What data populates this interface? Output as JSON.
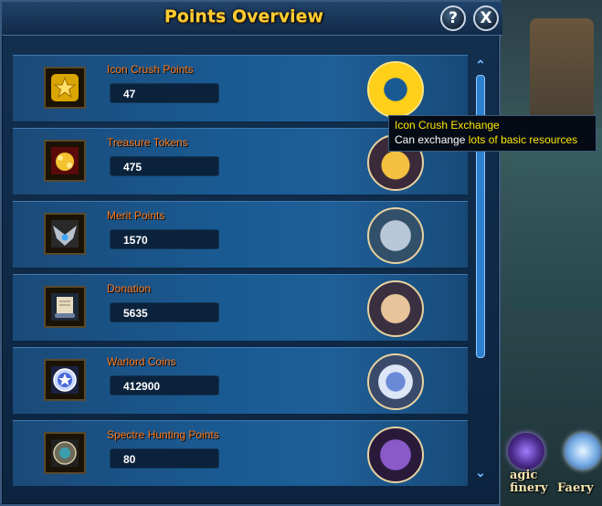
{
  "window": {
    "title": "Points Overview",
    "help_label": "?",
    "close_label": "X"
  },
  "points": [
    {
      "label": "Icon Crush Points",
      "value": "47",
      "icon": "star-icon",
      "medal": "gold-ring-icon"
    },
    {
      "label": "Treasure Tokens",
      "value": "475",
      "icon": "treasure-tokens-icon",
      "medal": "treasure-pile-icon"
    },
    {
      "label": "Merit Points",
      "value": "1570",
      "icon": "merit-emblem-icon",
      "medal": "chest-icon"
    },
    {
      "label": "Donation",
      "value": "5635",
      "icon": "scroll-icon",
      "medal": "money-bag-icon"
    },
    {
      "label": "Warlord Coins",
      "value": "412900",
      "icon": "pentagram-orb-icon",
      "medal": "winged-crest-icon"
    },
    {
      "label": "Spectre Hunting Points",
      "value": "80",
      "icon": "spectre-rune-icon",
      "medal": "purple-chest-icon"
    }
  ],
  "tooltip": {
    "title": "Icon Crush Exchange",
    "line_prefix": "Can exchange ",
    "line_highlight": "lots of basic resources"
  },
  "dock": {
    "item1_label": "agic\nfinery",
    "item2_label": "Faery"
  },
  "colors": {
    "title": "#ffcc33",
    "label": "#ff7a1a",
    "tooltip_highlight": "#ffe600"
  }
}
